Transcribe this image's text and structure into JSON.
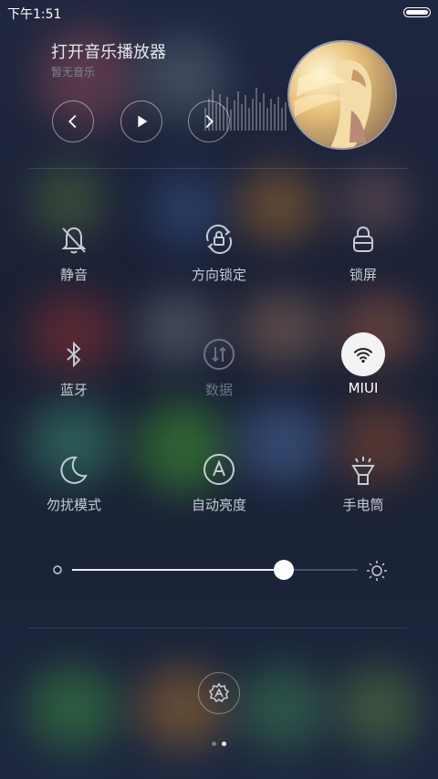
{
  "status_bar": {
    "time": "下午1:51",
    "battery_icon": "battery-icon"
  },
  "music": {
    "title": "打开音乐播放器",
    "subtitle": "暂无音乐",
    "controls": {
      "prev_icon": "chevron-left-icon",
      "play_icon": "play-icon",
      "next_icon": "chevron-right-icon"
    },
    "visualizer_icon": "equalizer-bars",
    "album_art": "album-art-blonde-girl"
  },
  "toggles": [
    {
      "label": "静音",
      "icon": "bell-off-icon",
      "state": "off"
    },
    {
      "label": "方向锁定",
      "icon": "rotation-lock-icon",
      "state": "off"
    },
    {
      "label": "锁屏",
      "icon": "lock-icon",
      "state": "off"
    },
    {
      "label": "蓝牙",
      "icon": "bluetooth-icon",
      "state": "off"
    },
    {
      "label": "数据",
      "icon": "data-transfer-icon",
      "state": "disabled"
    },
    {
      "label": "MIUI",
      "icon": "wifi-icon",
      "state": "on"
    },
    {
      "label": "勿扰模式",
      "icon": "moon-icon",
      "state": "off"
    },
    {
      "label": "自动亮度",
      "icon": "auto-brightness-icon",
      "state": "off"
    },
    {
      "label": "手电筒",
      "icon": "flashlight-icon",
      "state": "off"
    }
  ],
  "brightness": {
    "level": 0.74,
    "min_icon": "sun-small-icon",
    "max_icon": "sun-large-icon"
  },
  "settings_icon": "gear-icon",
  "pager": {
    "pages": 2,
    "current": 2
  },
  "colors": {
    "accent_on": "#f2f3f5",
    "text": "#c5cad5",
    "disabled": "#6c7386",
    "background": "#1b2236"
  }
}
